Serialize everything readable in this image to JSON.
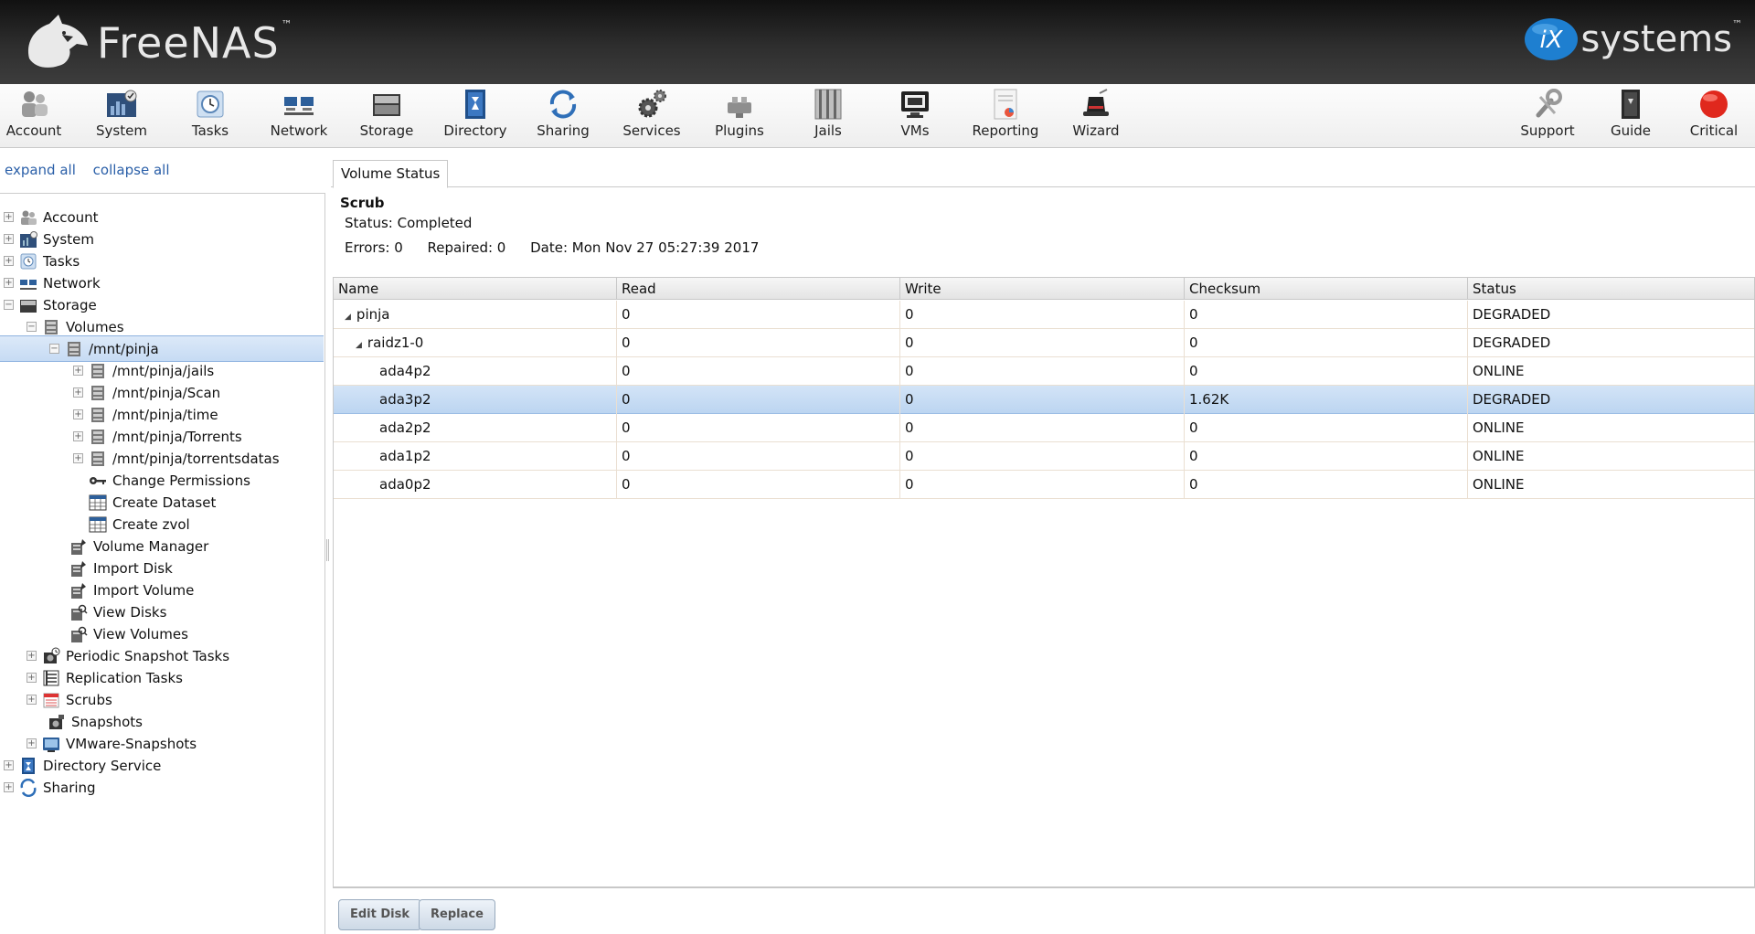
{
  "header": {
    "brand": "FreeNAS",
    "brand_tm": "™",
    "vendor_letters": "iX",
    "vendor_name": "systems",
    "vendor_tm": "™"
  },
  "toolbar": {
    "items": [
      {
        "label": "Account",
        "icon": "account-icon"
      },
      {
        "label": "System",
        "icon": "system-icon"
      },
      {
        "label": "Tasks",
        "icon": "tasks-icon"
      },
      {
        "label": "Network",
        "icon": "network-icon"
      },
      {
        "label": "Storage",
        "icon": "storage-icon"
      },
      {
        "label": "Directory",
        "icon": "directory-icon"
      },
      {
        "label": "Sharing",
        "icon": "sharing-icon"
      },
      {
        "label": "Services",
        "icon": "services-icon"
      },
      {
        "label": "Plugins",
        "icon": "plugins-icon"
      },
      {
        "label": "Jails",
        "icon": "jails-icon"
      },
      {
        "label": "VMs",
        "icon": "vms-icon"
      },
      {
        "label": "Reporting",
        "icon": "reporting-icon"
      },
      {
        "label": "Wizard",
        "icon": "wizard-icon"
      }
    ],
    "right_items": [
      {
        "label": "Support",
        "icon": "support-icon"
      },
      {
        "label": "Guide",
        "icon": "guide-icon"
      },
      {
        "label": "Critical",
        "icon": "critical-icon"
      }
    ]
  },
  "sidebar": {
    "expand_all": "expand all",
    "collapse_all": "collapse all",
    "tree": [
      {
        "label": "Account",
        "expander": "+",
        "icon": "account-icon"
      },
      {
        "label": "System",
        "expander": "+",
        "icon": "system-icon"
      },
      {
        "label": "Tasks",
        "expander": "+",
        "icon": "tasks-icon"
      },
      {
        "label": "Network",
        "expander": "+",
        "icon": "network-icon"
      },
      {
        "label": "Storage",
        "expander": "−",
        "icon": "storage-icon"
      },
      {
        "label": "Volumes",
        "expander": "−",
        "icon": "volume-icon"
      },
      {
        "label": "/mnt/pinja",
        "expander": "−",
        "icon": "volume-icon"
      },
      {
        "label": "/mnt/pinja/jails",
        "expander": "+",
        "icon": "dataset-icon"
      },
      {
        "label": "/mnt/pinja/Scan",
        "expander": "+",
        "icon": "dataset-icon"
      },
      {
        "label": "/mnt/pinja/time",
        "expander": "+",
        "icon": "dataset-icon"
      },
      {
        "label": "/mnt/pinja/Torrents",
        "expander": "+",
        "icon": "dataset-icon"
      },
      {
        "label": "/mnt/pinja/torrentsdatas",
        "expander": "+",
        "icon": "dataset-icon"
      },
      {
        "label": "Change Permissions",
        "expander": "",
        "icon": "key-icon"
      },
      {
        "label": "Create Dataset",
        "expander": "",
        "icon": "table-icon"
      },
      {
        "label": "Create zvol",
        "expander": "",
        "icon": "table-icon"
      },
      {
        "label": "Volume Manager",
        "expander": "",
        "icon": "volume-manager-icon"
      },
      {
        "label": "Import Disk",
        "expander": "",
        "icon": "import-disk-icon"
      },
      {
        "label": "Import Volume",
        "expander": "",
        "icon": "import-volume-icon"
      },
      {
        "label": "View Disks",
        "expander": "",
        "icon": "view-disks-icon"
      },
      {
        "label": "View Volumes",
        "expander": "",
        "icon": "view-volumes-icon"
      },
      {
        "label": "Periodic Snapshot Tasks",
        "expander": "+",
        "icon": "snapshot-task-icon"
      },
      {
        "label": "Replication Tasks",
        "expander": "+",
        "icon": "replication-icon"
      },
      {
        "label": "Scrubs",
        "expander": "+",
        "icon": "calendar-icon"
      },
      {
        "label": "Snapshots",
        "expander": "",
        "icon": "snapshot-icon"
      },
      {
        "label": "VMware-Snapshots",
        "expander": "+",
        "icon": "vmware-icon"
      },
      {
        "label": "Directory Service",
        "expander": "+",
        "icon": "directory-icon"
      },
      {
        "label": "Sharing",
        "expander": "+",
        "icon": "sharing-icon"
      }
    ]
  },
  "content": {
    "tab": "Volume Status",
    "scrub": {
      "title": "Scrub",
      "status": "Status: Completed",
      "errors": "Errors: 0",
      "repaired": "Repaired: 0",
      "date": "Date: Mon Nov 27 05:27:39 2017"
    },
    "grid": {
      "columns": [
        "Name",
        "Read",
        "Write",
        "Checksum",
        "Status"
      ],
      "rows": [
        {
          "name": "pinja",
          "read": "0",
          "write": "0",
          "checksum": "0",
          "status": "DEGRADED",
          "tri": "◢"
        },
        {
          "name": "raidz1-0",
          "read": "0",
          "write": "0",
          "checksum": "0",
          "status": "DEGRADED",
          "tri": "◢"
        },
        {
          "name": "ada4p2",
          "read": "0",
          "write": "0",
          "checksum": "0",
          "status": "ONLINE",
          "tri": ""
        },
        {
          "name": "ada3p2",
          "read": "0",
          "write": "0",
          "checksum": "1.62K",
          "status": "DEGRADED",
          "tri": ""
        },
        {
          "name": "ada2p2",
          "read": "0",
          "write": "0",
          "checksum": "0",
          "status": "ONLINE",
          "tri": ""
        },
        {
          "name": "ada1p2",
          "read": "0",
          "write": "0",
          "checksum": "0",
          "status": "ONLINE",
          "tri": ""
        },
        {
          "name": "ada0p2",
          "read": "0",
          "write": "0",
          "checksum": "0",
          "status": "ONLINE",
          "tri": ""
        }
      ]
    },
    "buttons": {
      "edit_disk": "Edit Disk",
      "replace": "Replace"
    }
  }
}
